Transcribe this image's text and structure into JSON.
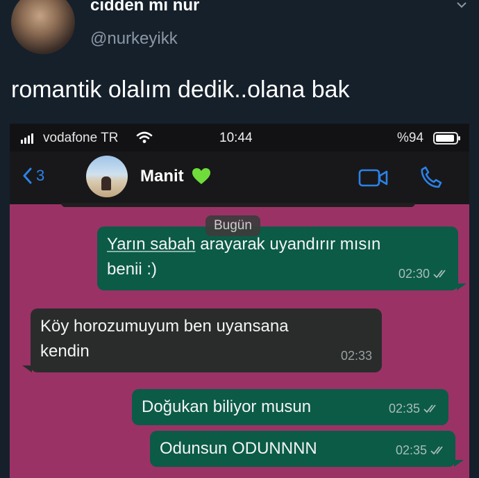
{
  "tweet": {
    "display_name": "cidden mi nur",
    "handle": "@nurkeyikk",
    "text": "romantik olalım dedik..olana bak",
    "menu_icon": "chevron-down-icon"
  },
  "status_bar": {
    "carrier": "vodafone TR",
    "time": "10:44",
    "battery": "%94",
    "signal_icon": "signal-bars-icon",
    "wifi_icon": "wifi-icon",
    "battery_icon": "battery-icon"
  },
  "chat_header": {
    "back_count": "3",
    "contact_name": "Manit",
    "contact_emoji": "green-heart-icon",
    "video_icon": "video-camera-icon",
    "phone_icon": "phone-icon",
    "accent_color": "#2c82e8"
  },
  "chat": {
    "date_label": "Bugün",
    "background_color": "#9b3266",
    "messages": [
      {
        "direction": "outgoing",
        "line1_underlined": "Yarın sabah",
        "line1_rest": " arayarak uyandırır mısın",
        "line2": "benii :)",
        "time": "02:30",
        "status_icon": "double-check-icon"
      },
      {
        "direction": "incoming",
        "line1": "Köy horozumuyum ben uyansana",
        "line2": "kendin",
        "time": "02:33"
      },
      {
        "direction": "outgoing",
        "text": "Doğukan biliyor musun",
        "time": "02:35",
        "status_icon": "double-check-icon"
      },
      {
        "direction": "outgoing",
        "text": "Odunsun ODUNNNN",
        "time": "02:35",
        "status_icon": "double-check-icon"
      }
    ]
  }
}
